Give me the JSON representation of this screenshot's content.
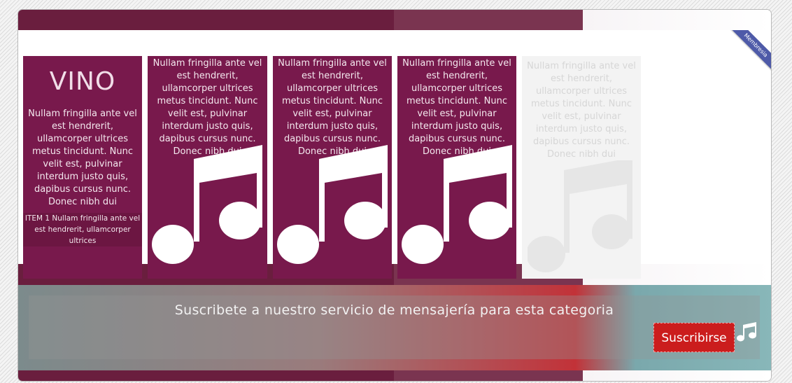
{
  "ribbon": {
    "label": "Membresia"
  },
  "category": {
    "title": "VINO",
    "description": "Nullam fringilla ante vel est hendrerit, ullamcorper ultrices metus tincidunt. Nunc velit est, pulvinar interdum justo quis, dapibus cursus nunc. Donec nibh dui",
    "item_caption": "ITEM 1 Nullam fringilla ante vel est hendrerit, ullamcorper ultrices"
  },
  "items": [
    {
      "text": "Nullam fringilla ante vel est hendrerit, ullamcorper ultrices metus tincidunt. Nunc velit est, pulvinar interdum justo quis, dapibus cursus nunc. Donec nibh dui",
      "icon": "music-note-icon"
    },
    {
      "text": "Nullam fringilla ante vel est hendrerit, ullamcorper ultrices metus tincidunt. Nunc velit est, pulvinar interdum justo quis, dapibus cursus nunc. Donec nibh dui",
      "icon": "music-note-icon"
    },
    {
      "text": "Nullam fringilla ante vel est hendrerit, ullamcorper ultrices metus tincidunt. Nunc velit est, pulvinar interdum justo quis, dapibus cursus nunc. Donec nibh dui",
      "icon": "music-note-icon"
    },
    {
      "text": "Nullam fringilla ante vel est hendrerit, ullamcorper ultrices metus tincidunt. Nunc velit est, pulvinar interdum justo quis, dapibus cursus nunc. Donec nibh dui",
      "icon": "music-note-icon"
    }
  ],
  "subscribe": {
    "message": "Suscribete a nuestro servicio de mensajería para esta categoria",
    "button_label": "Suscribirse",
    "icon": "music-note-icon"
  },
  "colors": {
    "panel": "#78194c",
    "band_dark": "#6a1e3e",
    "button": "#cb1d1d",
    "ribbon": "#4e5aa8"
  }
}
